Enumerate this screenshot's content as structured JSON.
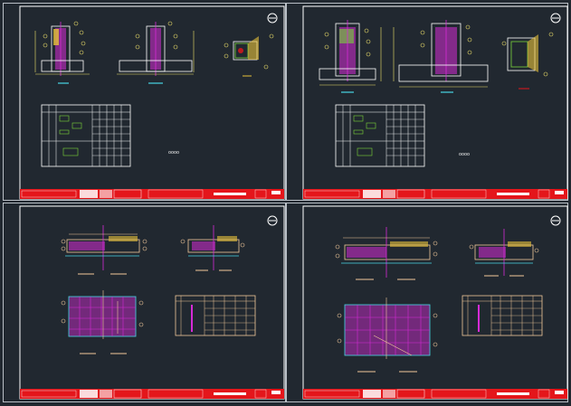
{
  "sheets": [
    {
      "id": "sheet-1",
      "table_marker": "oooo"
    },
    {
      "id": "sheet-2",
      "table_marker": "oooo"
    },
    {
      "id": "sheet-3",
      "table_marker": ""
    },
    {
      "id": "sheet-4",
      "table_marker": ""
    }
  ],
  "colors": {
    "background": "#212830",
    "frame": "#ffffff",
    "titlebar": "#e4161b",
    "dimension": "#f0e26a",
    "rebar": "#d62bd6",
    "concrete": "#ffffff",
    "hatch": "#e7c23a",
    "callout": "#f2c99a",
    "accent_cyan": "#47d6e6",
    "accent_green": "#7ad43a"
  },
  "icons": {
    "north_marker": "circle-minus-icon"
  }
}
